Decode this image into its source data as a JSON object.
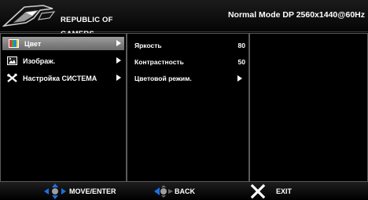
{
  "header": {
    "brand_line1": "REPUBLIC OF",
    "brand_line2": "GAMERS",
    "mode_info": "Normal Mode DP 2560x1440@60Hz"
  },
  "main_menu": [
    {
      "label": "Цвет",
      "icon": "color-bars-icon",
      "selected": true
    },
    {
      "label": "Изображ.",
      "icon": "image-icon",
      "selected": false
    },
    {
      "label": "Настройка СИСТЕМА",
      "icon": "tools-icon",
      "selected": false
    }
  ],
  "sub_menu": [
    {
      "label": "Яркость",
      "value": "80"
    },
    {
      "label": "Контрастность",
      "value": "50"
    },
    {
      "label": "Цветовой режим.",
      "value": null
    }
  ],
  "footer": {
    "move_label": "MOVE/ENTER",
    "back_label": "BACK",
    "exit_label": "EXIT"
  },
  "colors": {
    "background": "#000000",
    "selection": "#8a8a8a",
    "nav_blue": "#1e6fe8",
    "border": "#5a5a5a"
  }
}
